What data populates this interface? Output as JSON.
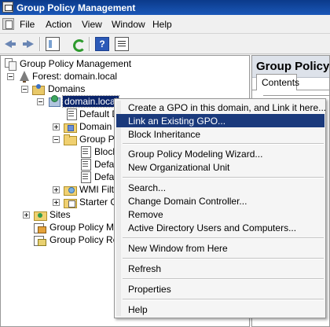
{
  "window": {
    "title": "Group Policy Management"
  },
  "menubar": {
    "items": [
      "File",
      "Action",
      "View",
      "Window",
      "Help"
    ]
  },
  "toolbar": {
    "help_label": "?"
  },
  "tree": {
    "root": "Group Policy Management",
    "forest": "Forest: domain.local",
    "domains": "Domains",
    "domain": "domain.local",
    "default_domain": "Default D",
    "domain_controllers": "Domain C",
    "group_policy_objects": "Group Po",
    "gpo_block": "Block",
    "gpo_default1": "Defa",
    "gpo_default2": "Defa",
    "wmi_filters": "WMI Filte",
    "starter_gpos": "Starter G",
    "sites": "Sites",
    "modeling": "Group Policy Mod",
    "results": "Group Policy Res"
  },
  "right_pane": {
    "title": "Group Policy",
    "tab": "Contents"
  },
  "context_menu": {
    "items": [
      "Create a GPO in this domain, and Link it here...",
      "Link an Existing GPO...",
      "Block Inheritance",
      "Group Policy Modeling Wizard...",
      "New Organizational Unit",
      "Search...",
      "Change Domain Controller...",
      "Remove",
      "Active Directory Users and Computers...",
      "New Window from Here",
      "Refresh",
      "Properties",
      "Help"
    ],
    "highlighted": "Link an Existing GPO..."
  },
  "colors": {
    "selection": "#0a246a",
    "menu_highlight": "#1b3a7c",
    "title_bar": "#0b3a8a"
  }
}
